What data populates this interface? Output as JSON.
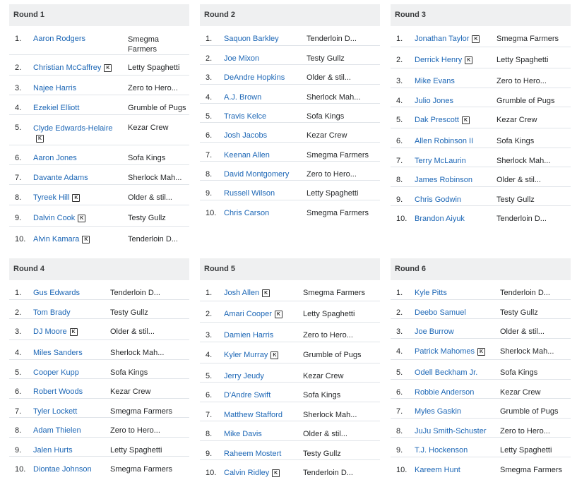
{
  "rounds": [
    {
      "title": "Round 1",
      "picks": [
        {
          "num": "1.",
          "player": "Aaron Rodgers",
          "team": "Smegma Farmers",
          "keeper": false
        },
        {
          "num": "2.",
          "player": "Christian McCaffrey",
          "team": "Letty Spaghetti",
          "keeper": true
        },
        {
          "num": "3.",
          "player": "Najee Harris",
          "team": "Zero to Hero...",
          "keeper": false
        },
        {
          "num": "4.",
          "player": "Ezekiel Elliott",
          "team": "Grumble of Pugs",
          "keeper": false
        },
        {
          "num": "5.",
          "player": "Clyde Edwards-Helaire",
          "team": "Kezar Crew",
          "keeper": true
        },
        {
          "num": "6.",
          "player": "Aaron Jones",
          "team": "Sofa Kings",
          "keeper": false
        },
        {
          "num": "7.",
          "player": "Davante Adams",
          "team": "Sherlock Mah...",
          "keeper": false
        },
        {
          "num": "8.",
          "player": "Tyreek Hill",
          "team": "Older & stil...",
          "keeper": true
        },
        {
          "num": "9.",
          "player": "Dalvin Cook",
          "team": "Testy Gullz",
          "keeper": true
        },
        {
          "num": "10.",
          "player": "Alvin Kamara",
          "team": "Tenderloin D...",
          "keeper": true
        }
      ]
    },
    {
      "title": "Round 2",
      "picks": [
        {
          "num": "1.",
          "player": "Saquon Barkley",
          "team": "Tenderloin D...",
          "keeper": false
        },
        {
          "num": "2.",
          "player": "Joe Mixon",
          "team": "Testy Gullz",
          "keeper": false
        },
        {
          "num": "3.",
          "player": "DeAndre Hopkins",
          "team": "Older & stil...",
          "keeper": false
        },
        {
          "num": "4.",
          "player": "A.J. Brown",
          "team": "Sherlock Mah...",
          "keeper": false
        },
        {
          "num": "5.",
          "player": "Travis Kelce",
          "team": "Sofa Kings",
          "keeper": false
        },
        {
          "num": "6.",
          "player": "Josh Jacobs",
          "team": "Kezar Crew",
          "keeper": false
        },
        {
          "num": "7.",
          "player": "Keenan Allen",
          "team": "Smegma Farmers",
          "keeper": false
        },
        {
          "num": "8.",
          "player": "David Montgomery",
          "team": "Zero to Hero...",
          "keeper": false
        },
        {
          "num": "9.",
          "player": "Russell Wilson",
          "team": "Letty Spaghetti",
          "keeper": false
        },
        {
          "num": "10.",
          "player": "Chris Carson",
          "team": "Smegma Farmers",
          "keeper": false
        }
      ]
    },
    {
      "title": "Round 3",
      "picks": [
        {
          "num": "1.",
          "player": "Jonathan Taylor",
          "team": "Smegma Farmers",
          "keeper": true
        },
        {
          "num": "2.",
          "player": "Derrick Henry",
          "team": "Letty Spaghetti",
          "keeper": true
        },
        {
          "num": "3.",
          "player": "Mike Evans",
          "team": "Zero to Hero...",
          "keeper": false
        },
        {
          "num": "4.",
          "player": "Julio Jones",
          "team": "Grumble of Pugs",
          "keeper": false
        },
        {
          "num": "5.",
          "player": "Dak Prescott",
          "team": "Kezar Crew",
          "keeper": true
        },
        {
          "num": "6.",
          "player": "Allen Robinson II",
          "team": "Sofa Kings",
          "keeper": false
        },
        {
          "num": "7.",
          "player": "Terry McLaurin",
          "team": "Sherlock Mah...",
          "keeper": false
        },
        {
          "num": "8.",
          "player": "James Robinson",
          "team": "Older & stil...",
          "keeper": false
        },
        {
          "num": "9.",
          "player": "Chris Godwin",
          "team": "Testy Gullz",
          "keeper": false
        },
        {
          "num": "10.",
          "player": "Brandon Aiyuk",
          "team": "Tenderloin D...",
          "keeper": false
        }
      ]
    },
    {
      "title": "Round 4",
      "picks": [
        {
          "num": "1.",
          "player": "Gus Edwards",
          "team": "Tenderloin D...",
          "keeper": false
        },
        {
          "num": "2.",
          "player": "Tom Brady",
          "team": "Testy Gullz",
          "keeper": false
        },
        {
          "num": "3.",
          "player": "DJ Moore",
          "team": "Older & stil...",
          "keeper": true
        },
        {
          "num": "4.",
          "player": "Miles Sanders",
          "team": "Sherlock Mah...",
          "keeper": false
        },
        {
          "num": "5.",
          "player": "Cooper Kupp",
          "team": "Sofa Kings",
          "keeper": false
        },
        {
          "num": "6.",
          "player": "Robert Woods",
          "team": "Kezar Crew",
          "keeper": false
        },
        {
          "num": "7.",
          "player": "Tyler Lockett",
          "team": "Smegma Farmers",
          "keeper": false
        },
        {
          "num": "8.",
          "player": "Adam Thielen",
          "team": "Zero to Hero...",
          "keeper": false
        },
        {
          "num": "9.",
          "player": "Jalen Hurts",
          "team": "Letty Spaghetti",
          "keeper": false
        },
        {
          "num": "10.",
          "player": "Diontae Johnson",
          "team": "Smegma Farmers",
          "keeper": false
        }
      ]
    },
    {
      "title": "Round 5",
      "picks": [
        {
          "num": "1.",
          "player": "Josh Allen",
          "team": "Smegma Farmers",
          "keeper": true
        },
        {
          "num": "2.",
          "player": "Amari Cooper",
          "team": "Letty Spaghetti",
          "keeper": true
        },
        {
          "num": "3.",
          "player": "Damien Harris",
          "team": "Zero to Hero...",
          "keeper": false
        },
        {
          "num": "4.",
          "player": "Kyler Murray",
          "team": "Grumble of Pugs",
          "keeper": true
        },
        {
          "num": "5.",
          "player": "Jerry Jeudy",
          "team": "Kezar Crew",
          "keeper": false
        },
        {
          "num": "6.",
          "player": "D'Andre Swift",
          "team": "Sofa Kings",
          "keeper": false
        },
        {
          "num": "7.",
          "player": "Matthew Stafford",
          "team": "Sherlock Mah...",
          "keeper": false
        },
        {
          "num": "8.",
          "player": "Mike Davis",
          "team": "Older & stil...",
          "keeper": false
        },
        {
          "num": "9.",
          "player": "Raheem Mostert",
          "team": "Testy Gullz",
          "keeper": false
        },
        {
          "num": "10.",
          "player": "Calvin Ridley",
          "team": "Tenderloin D...",
          "keeper": true
        }
      ]
    },
    {
      "title": "Round 6",
      "picks": [
        {
          "num": "1.",
          "player": "Kyle Pitts",
          "team": "Tenderloin D...",
          "keeper": false
        },
        {
          "num": "2.",
          "player": "Deebo Samuel",
          "team": "Testy Gullz",
          "keeper": false
        },
        {
          "num": "3.",
          "player": "Joe Burrow",
          "team": "Older & stil...",
          "keeper": false
        },
        {
          "num": "4.",
          "player": "Patrick Mahomes",
          "team": "Sherlock Mah...",
          "keeper": true
        },
        {
          "num": "5.",
          "player": "Odell Beckham Jr.",
          "team": "Sofa Kings",
          "keeper": false
        },
        {
          "num": "6.",
          "player": "Robbie Anderson",
          "team": "Kezar Crew",
          "keeper": false
        },
        {
          "num": "7.",
          "player": "Myles Gaskin",
          "team": "Grumble of Pugs",
          "keeper": false
        },
        {
          "num": "8.",
          "player": "JuJu Smith-Schuster",
          "team": "Zero to Hero...",
          "keeper": false
        },
        {
          "num": "9.",
          "player": "T.J. Hockenson",
          "team": "Letty Spaghetti",
          "keeper": false
        },
        {
          "num": "10.",
          "player": "Kareem Hunt",
          "team": "Smegma Farmers",
          "keeper": false
        }
      ]
    }
  ],
  "keeper_badge": "K",
  "colors": {
    "link": "#1d67b6",
    "header_bg": "#eff0f1",
    "divider": "#e0e4e9"
  }
}
